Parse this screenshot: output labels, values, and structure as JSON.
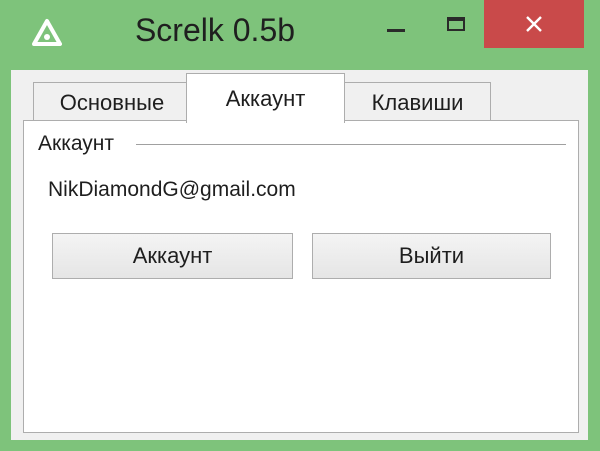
{
  "window": {
    "title": "Screlk 0.5b",
    "icon": "triangle-logo-icon",
    "titlebar_color": "#7ec37b",
    "close_color": "#c94a4a"
  },
  "tabs": [
    {
      "label": "Основные",
      "active": false
    },
    {
      "label": "Аккаунт",
      "active": true
    },
    {
      "label": "Клавиши",
      "active": false
    }
  ],
  "account_panel": {
    "group_title": "Аккаунт",
    "email": "NikDiamondG@gmail.com",
    "account_button": "Аккаунт",
    "logout_button": "Выйти"
  }
}
